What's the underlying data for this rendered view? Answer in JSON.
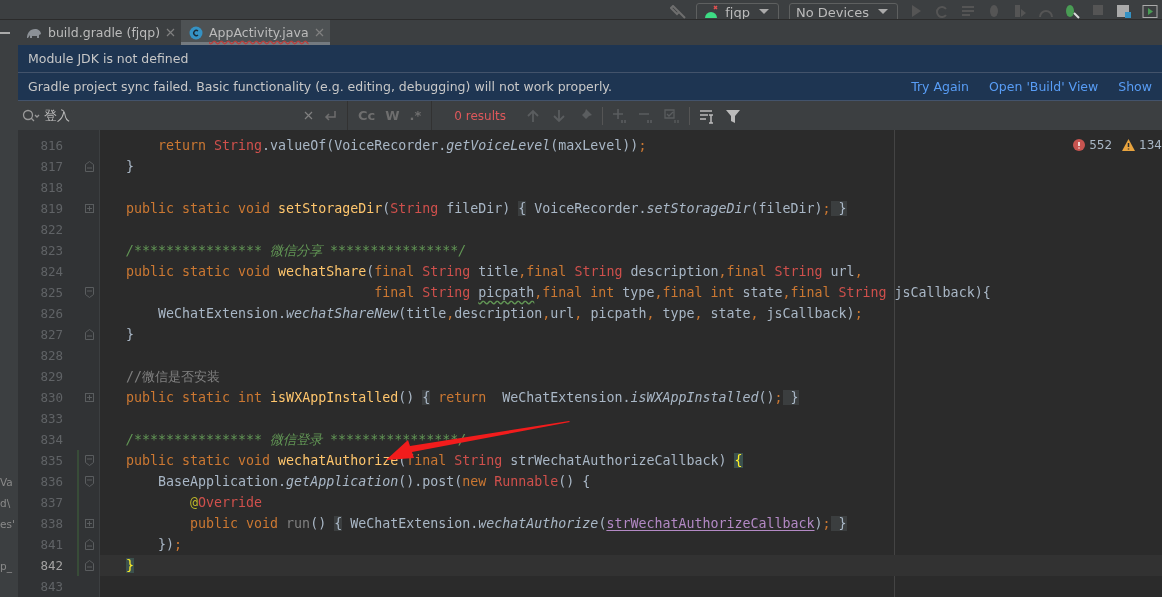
{
  "toolbar": {
    "run_config": {
      "label": "fjqp"
    },
    "device": {
      "label": "No Devices"
    }
  },
  "tabs": [
    {
      "label": "build.gradle (fjqp)",
      "kind": "gradle",
      "selected": false
    },
    {
      "label": "AppActivity.java",
      "kind": "java",
      "selected": true
    }
  ],
  "banners": [
    {
      "message": "Module JDK is not defined"
    },
    {
      "message": "Gradle project sync failed. Basic functionality (e.g. editing, debugging) will not work properly.",
      "actions": [
        "Try Again",
        "Open 'Build' View",
        "Show"
      ]
    }
  ],
  "search": {
    "value": "登入",
    "result": "0 results",
    "toggles": [
      {
        "label": "Cc",
        "on": false
      },
      {
        "label": "W",
        "on": false
      },
      {
        "label": ".*",
        "on": false
      }
    ]
  },
  "problems": {
    "errors": "552",
    "warnings": "134"
  },
  "editor": {
    "lines": [
      {
        "number": "816",
        "kind": "plain",
        "changed": false,
        "current": false,
        "tokens": [
          {
            "text": "    return ",
            "kind": "kw"
          },
          {
            "text": "String",
            "kind": "type"
          },
          {
            "text": ".valueOf(VoiceRecorder.",
            "kind": "plain"
          },
          {
            "text": "getVoiceLevel",
            "kind": "italic"
          },
          {
            "text": "(maxLevel))",
            "kind": "plain"
          },
          {
            "text": ";",
            "kind": "punct"
          }
        ]
      },
      {
        "number": "817",
        "kind": "fold_end",
        "changed": false,
        "current": false,
        "tokens": [
          {
            "text": "}",
            "kind": "plain"
          }
        ]
      },
      {
        "number": "818",
        "kind": "plain",
        "changed": false,
        "current": false
      },
      {
        "number": "819",
        "kind": "collapsed",
        "changed": false,
        "current": false,
        "tokens": [
          {
            "text": "public static void ",
            "kind": "kw"
          },
          {
            "text": "setStorageDir",
            "kind": "fn"
          },
          {
            "text": "(",
            "kind": "plain"
          },
          {
            "text": "String",
            "kind": "type"
          },
          {
            "text": " fileDir) ",
            "kind": "plain"
          },
          {
            "text": "{",
            "kind": "fold"
          },
          {
            "text": " VoiceRecorder.",
            "kind": "plain"
          },
          {
            "text": "setStorageDir",
            "kind": "italic"
          },
          {
            "text": "(fileDir)",
            "kind": "plain"
          },
          {
            "text": ";",
            "kind": "punct"
          },
          {
            "text": " }",
            "kind": "fold"
          }
        ]
      },
      {
        "number": "822",
        "kind": "plain",
        "changed": false,
        "current": false
      },
      {
        "number": "823",
        "kind": "plain",
        "changed": false,
        "current": false,
        "tokens": [
          {
            "text": "/**************** 微信分享 ****************/",
            "kind": "doc"
          }
        ]
      },
      {
        "number": "824",
        "kind": "plain",
        "changed": false,
        "current": false,
        "tokens": [
          {
            "text": "public static void ",
            "kind": "kw"
          },
          {
            "text": "wechatShare",
            "kind": "fn"
          },
          {
            "text": "(",
            "kind": "plain"
          },
          {
            "text": "final ",
            "kind": "kw"
          },
          {
            "text": "String",
            "kind": "type"
          },
          {
            "text": " title",
            "kind": "plain"
          },
          {
            "text": ",final ",
            "kind": "kw"
          },
          {
            "text": "String",
            "kind": "type"
          },
          {
            "text": " description",
            "kind": "plain"
          },
          {
            "text": ",final ",
            "kind": "kw"
          },
          {
            "text": "String",
            "kind": "type"
          },
          {
            "text": " url",
            "kind": "plain"
          },
          {
            "text": ",",
            "kind": "punct"
          }
        ]
      },
      {
        "number": "825",
        "kind": "fold_start",
        "changed": false,
        "current": false,
        "tokens": [
          {
            "text": "                               final ",
            "kind": "kw"
          },
          {
            "text": "String ",
            "kind": "type"
          },
          {
            "text": "picpath",
            "kind": "typo"
          },
          {
            "text": ",final int ",
            "kind": "kw"
          },
          {
            "text": "type",
            "kind": "plain"
          },
          {
            "text": ",final int ",
            "kind": "kw"
          },
          {
            "text": "state",
            "kind": "plain"
          },
          {
            "text": ",final ",
            "kind": "kw"
          },
          {
            "text": "String",
            "kind": "type"
          },
          {
            "text": " jsCallback){",
            "kind": "plain"
          }
        ]
      },
      {
        "number": "826",
        "kind": "plain",
        "changed": false,
        "current": false,
        "tokens": [
          {
            "text": "    WeChatExtension.",
            "kind": "plain"
          },
          {
            "text": "wechatShareNew",
            "kind": "italic"
          },
          {
            "text": "(title",
            "kind": "plain"
          },
          {
            "text": ",",
            "kind": "punct"
          },
          {
            "text": "description",
            "kind": "plain"
          },
          {
            "text": ",",
            "kind": "punct"
          },
          {
            "text": "url",
            "kind": "plain"
          },
          {
            "text": ",",
            "kind": "punct"
          },
          {
            "text": " picpath",
            "kind": "plain"
          },
          {
            "text": ",",
            "kind": "punct"
          },
          {
            "text": " type",
            "kind": "plain"
          },
          {
            "text": ",",
            "kind": "punct"
          },
          {
            "text": " state",
            "kind": "plain"
          },
          {
            "text": ",",
            "kind": "punct"
          },
          {
            "text": " jsCallback)",
            "kind": "plain"
          },
          {
            "text": ";",
            "kind": "punct"
          }
        ]
      },
      {
        "number": "827",
        "kind": "fold_end",
        "changed": false,
        "current": false,
        "tokens": [
          {
            "text": "}",
            "kind": "plain"
          }
        ]
      },
      {
        "number": "828",
        "kind": "plain",
        "changed": false,
        "current": false
      },
      {
        "number": "829",
        "kind": "plain",
        "changed": false,
        "current": false,
        "tokens": [
          {
            "text": "//微信是否安装",
            "kind": "comment"
          }
        ]
      },
      {
        "number": "830",
        "kind": "collapsed",
        "changed": false,
        "current": false,
        "tokens": [
          {
            "text": "public static int ",
            "kind": "kw"
          },
          {
            "text": "isWXAppInstalled",
            "kind": "fn"
          },
          {
            "text": "() ",
            "kind": "plain"
          },
          {
            "text": "{",
            "kind": "fold"
          },
          {
            "text": " return  ",
            "kind": "kw"
          },
          {
            "text": "WeChatExtension.",
            "kind": "plain"
          },
          {
            "text": "isWXAppInstalled",
            "kind": "italic"
          },
          {
            "text": "()",
            "kind": "plain"
          },
          {
            "text": ";",
            "kind": "punct"
          },
          {
            "text": " }",
            "kind": "fold"
          }
        ]
      },
      {
        "number": "833",
        "kind": "plain",
        "changed": false,
        "current": false
      },
      {
        "number": "834",
        "kind": "plain",
        "changed": false,
        "current": false,
        "tokens": [
          {
            "text": "/**************** 微信登录 ****************/",
            "kind": "doc"
          }
        ]
      },
      {
        "number": "835",
        "kind": "fold_start",
        "changed": true,
        "current": false,
        "tokens": [
          {
            "text": "public static void ",
            "kind": "kw"
          },
          {
            "text": "wechatAuthorize",
            "kind": "fn"
          },
          {
            "text": "(",
            "kind": "plain"
          },
          {
            "text": "final ",
            "kind": "kw"
          },
          {
            "text": "String",
            "kind": "type"
          },
          {
            "text": " strWechatAuthorizeCallback) ",
            "kind": "plain"
          },
          {
            "text": "{",
            "kind": "brace"
          }
        ]
      },
      {
        "number": "836",
        "kind": "fold_start",
        "changed": true,
        "current": false,
        "panel_fragment": "Va",
        "tokens": [
          {
            "text": "    BaseApplication.",
            "kind": "plain"
          },
          {
            "text": "getApplication",
            "kind": "italic"
          },
          {
            "text": "().post(",
            "kind": "plain"
          },
          {
            "text": "new ",
            "kind": "kw"
          },
          {
            "text": "Runnable",
            "kind": "type"
          },
          {
            "text": "() {",
            "kind": "plain"
          }
        ]
      },
      {
        "number": "837",
        "kind": "plain",
        "changed": true,
        "current": false,
        "panel_fragment": "d\\",
        "tokens": [
          {
            "text": "        @",
            "kind": "anno"
          },
          {
            "text": "Override",
            "kind": "type"
          }
        ]
      },
      {
        "number": "838",
        "kind": "collapsed",
        "changed": true,
        "current": false,
        "panel_fragment": "es'",
        "tokens": [
          {
            "text": "        public void ",
            "kind": "kw"
          },
          {
            "text": "run",
            "kind": "dim"
          },
          {
            "text": "() ",
            "kind": "plain"
          },
          {
            "text": "{",
            "kind": "fold"
          },
          {
            "text": " WeChatExtension.",
            "kind": "plain"
          },
          {
            "text": "wechatAuthorize",
            "kind": "italic"
          },
          {
            "text": "(",
            "kind": "plain"
          },
          {
            "text": "strWechatAuthorizeCallback",
            "kind": "param"
          },
          {
            "text": ")",
            "kind": "plain"
          },
          {
            "text": ";",
            "kind": "punct"
          },
          {
            "text": " }",
            "kind": "fold"
          }
        ]
      },
      {
        "number": "841",
        "kind": "fold_end",
        "changed": true,
        "current": false,
        "tokens": [
          {
            "text": "    })",
            "kind": "plain"
          },
          {
            "text": ";",
            "kind": "punct"
          }
        ]
      },
      {
        "number": "842",
        "kind": "fold_end",
        "changed": true,
        "current": true,
        "panel_fragment": "p_",
        "tokens": [
          {
            "text": "}",
            "kind": "brace"
          }
        ]
      },
      {
        "number": "843",
        "kind": "plain",
        "changed": false,
        "current": false
      }
    ]
  }
}
